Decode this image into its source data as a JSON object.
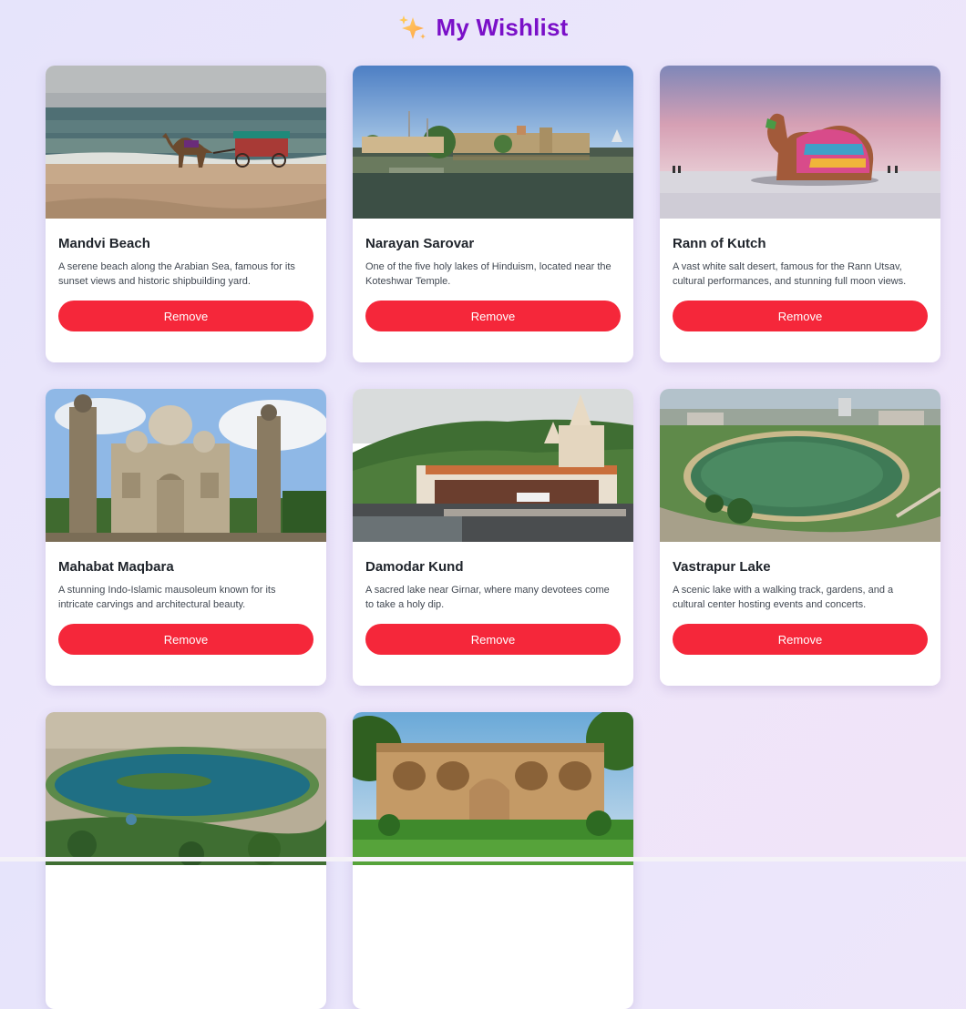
{
  "header": {
    "title": "My Wishlist",
    "icon": "sparkles-icon"
  },
  "colors": {
    "title": "#7a10c8",
    "remove_button": "#f5273a",
    "card_bg": "#ffffff"
  },
  "cards": [
    {
      "id": "mandvi",
      "title": "Mandvi Beach",
      "description": "A serene beach along the Arabian Sea, famous for its sunset views and historic shipbuilding yard.",
      "button": "Remove"
    },
    {
      "id": "narayan",
      "title": "Narayan Sarovar",
      "description": "One of the five holy lakes of Hinduism, located near the Koteshwar Temple.",
      "button": "Remove"
    },
    {
      "id": "rann",
      "title": "Rann of Kutch",
      "description": "A vast white salt desert, famous for the Rann Utsav, cultural performances, and stunning full moon views.",
      "button": "Remove"
    },
    {
      "id": "mahabat",
      "title": "Mahabat Maqbara",
      "description": "A stunning Indo-Islamic mausoleum known for its intricate carvings and architectural beauty.",
      "button": "Remove"
    },
    {
      "id": "damodar",
      "title": "Damodar Kund",
      "description": "A sacred lake near Girnar, where many devotees come to take a holy dip.",
      "button": "Remove"
    },
    {
      "id": "vastrapur",
      "title": "Vastrapur Lake",
      "description": "A scenic lake with a walking track, gardens, and a cultural center hosting events and concerts.",
      "button": "Remove"
    },
    {
      "id": "kankaria",
      "title": "",
      "description": "",
      "button": ""
    },
    {
      "id": "sidi",
      "title": "",
      "description": "",
      "button": ""
    }
  ]
}
